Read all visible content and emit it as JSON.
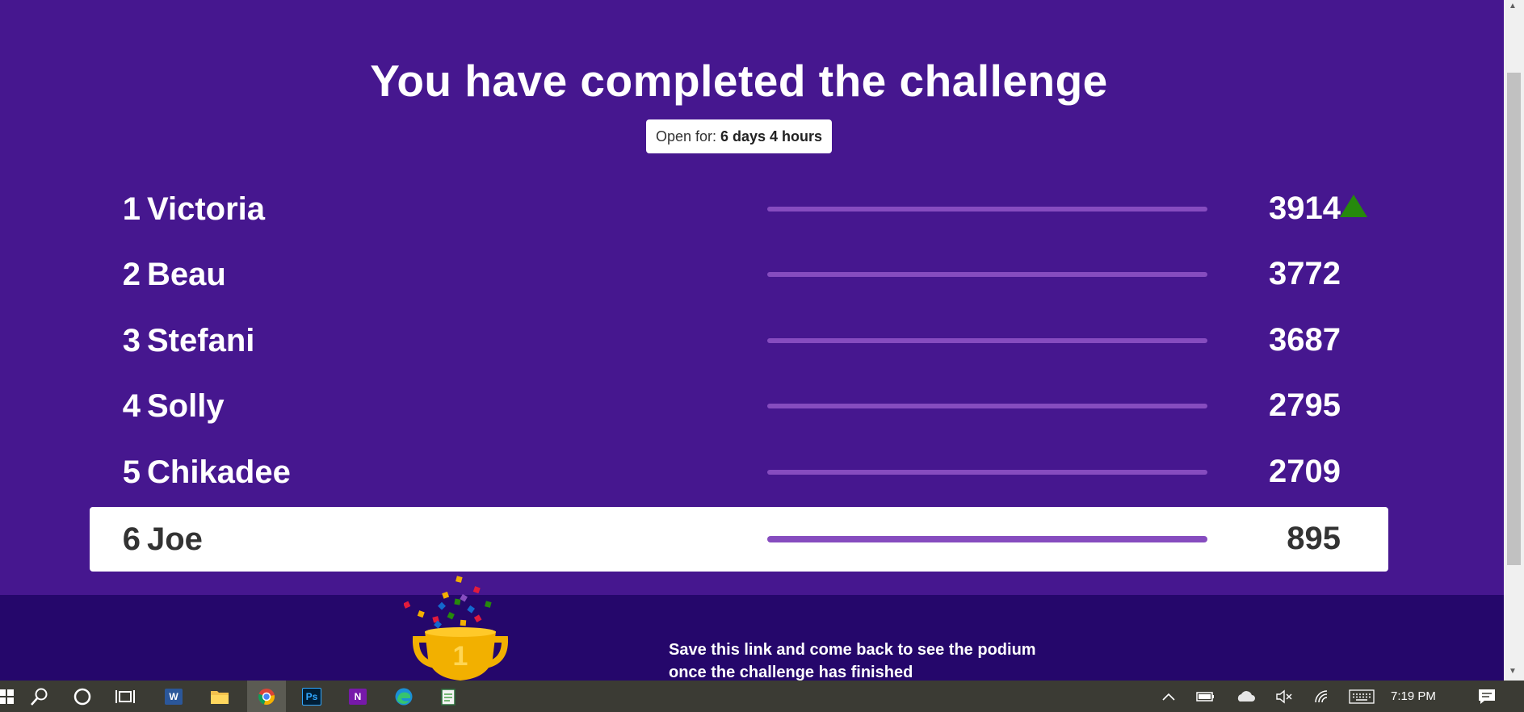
{
  "title": "You have completed the challenge",
  "open_badge": {
    "label": "Open for:",
    "value": "6 days 4 hours"
  },
  "leaderboard": [
    {
      "rank": "1",
      "name": "Victoria",
      "score": "3914",
      "trend": "up"
    },
    {
      "rank": "2",
      "name": "Beau",
      "score": "3772"
    },
    {
      "rank": "3",
      "name": "Stefani",
      "score": "3687"
    },
    {
      "rank": "4",
      "name": "Solly",
      "score": "2795"
    },
    {
      "rank": "5",
      "name": "Chikadee",
      "score": "2709"
    },
    {
      "rank": "6",
      "name": "Joe",
      "score": "895",
      "current_user": true
    }
  ],
  "footer": {
    "line1": "Save this link and come back to see the podium",
    "line2": "once the challenge has finished",
    "trophy_number": "1"
  },
  "taskbar": {
    "apps": [
      "start-icon",
      "search-icon",
      "cortana-icon",
      "task-view-icon",
      "word-icon",
      "file-explorer-icon",
      "chrome-icon",
      "photoshop-icon",
      "onenote-icon",
      "edge-icon",
      "notepad-icon"
    ],
    "word_letter": "W",
    "photoshop_letters": "Ps",
    "onenote_letter": "N",
    "clock": "7:19 PM"
  },
  "colors": {
    "background": "#46178f",
    "footer": "#25076b",
    "bar": "#864cbf",
    "trend_up": "#26890c",
    "trophy": "#f2b000"
  }
}
